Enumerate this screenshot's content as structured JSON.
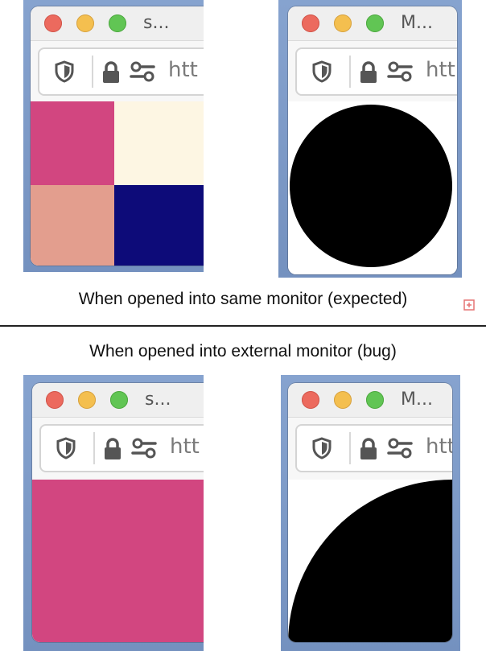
{
  "captions": {
    "expected": "When opened into same monitor (expected)",
    "bug": "When opened into external monitor (bug)"
  },
  "windows": [
    {
      "id": "top-left",
      "title": "s...",
      "url": "htt",
      "content": "grid",
      "grid_colors": [
        "#d24680",
        "#fdf6e3",
        "#e39e8e",
        "#0d0b79"
      ]
    },
    {
      "id": "top-right",
      "title": "M...",
      "url": "htt",
      "content": "circle"
    },
    {
      "id": "bottom-left",
      "title": "s...",
      "url": "htt",
      "content": "solid",
      "fill": "#d24680"
    },
    {
      "id": "bottom-right",
      "title": "M...",
      "url": "htt",
      "content": "quarter-circle"
    }
  ],
  "colors": {
    "desktop_blue": "#7f9fcd",
    "pink": "#d24680",
    "cream": "#fdf6e3",
    "salmon": "#e39e8e",
    "navy": "#0d0b79",
    "circle": "#000000"
  },
  "icons": [
    "shield-icon",
    "lock-icon",
    "permissions-icon",
    "add-icon"
  ]
}
